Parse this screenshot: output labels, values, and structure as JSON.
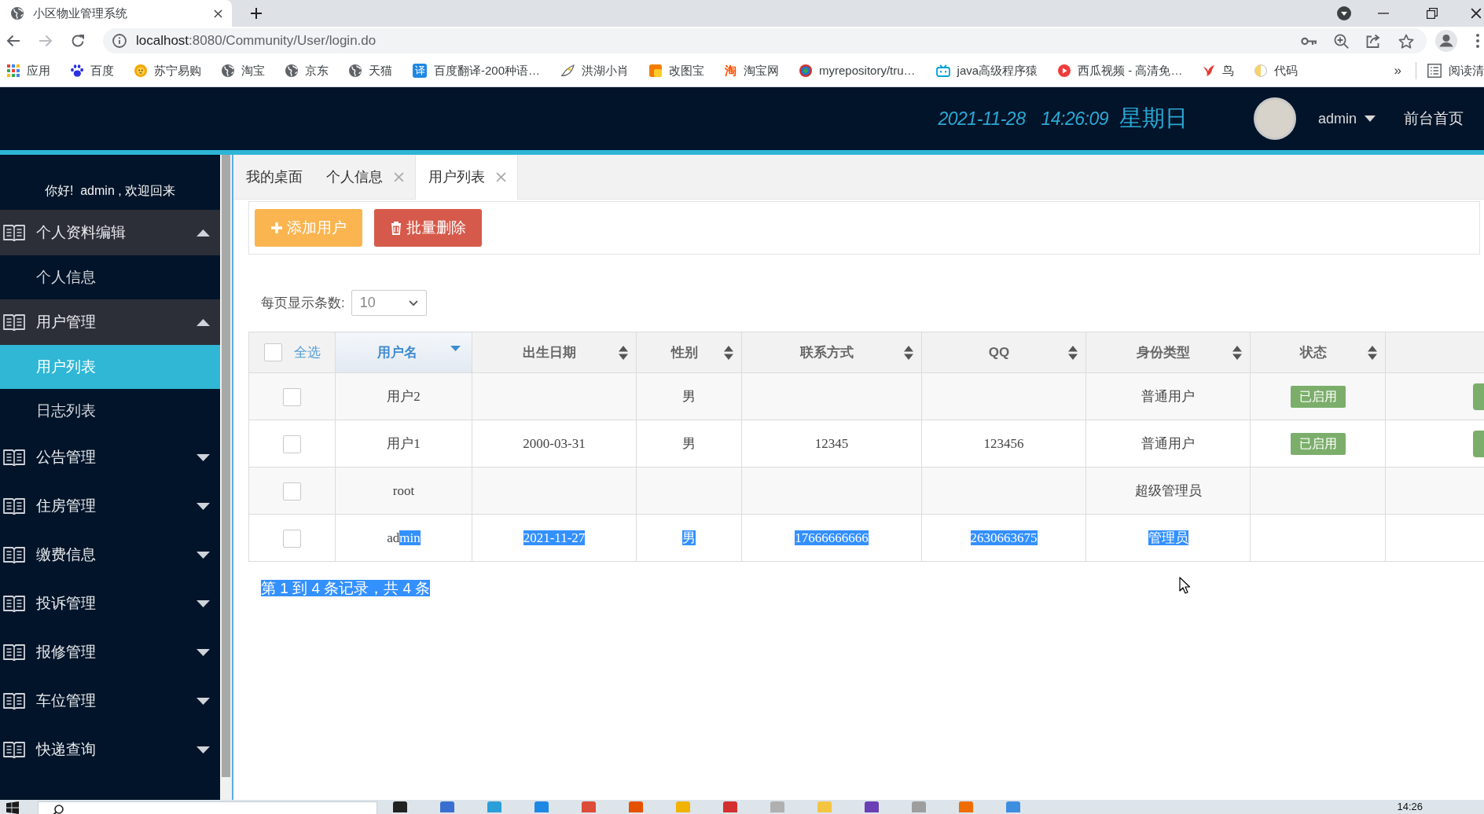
{
  "browser": {
    "tab_title": "小区物业管理系统",
    "nav": [
      {
        "kind": "back",
        "disabled": false
      },
      {
        "kind": "forward",
        "disabled": true
      },
      {
        "kind": "reload",
        "disabled": false
      }
    ],
    "url": {
      "host": "localhost",
      "rest": ":8080/Community/User/login.do"
    },
    "bookmarks": [
      {
        "label": "应用",
        "kind": "apps"
      },
      {
        "label": "百度",
        "kind": "paw"
      },
      {
        "label": "苏宁易购",
        "kind": "lion"
      },
      {
        "label": "淘宝",
        "kind": "globe"
      },
      {
        "label": "京东",
        "kind": "globe"
      },
      {
        "label": "天猫",
        "kind": "globe"
      },
      {
        "label": "百度翻译-200种语…",
        "kind": "glyph_tile",
        "glyph": "译"
      },
      {
        "label": "洪湖小肖",
        "kind": "doodle"
      },
      {
        "label": "改图宝",
        "kind": "tile"
      },
      {
        "label": "淘宝网",
        "kind": "glyph",
        "glyph": "淘"
      },
      {
        "label": "myrepository/tru…",
        "kind": "ring"
      },
      {
        "label": "java高级程序猿",
        "kind": "tv"
      },
      {
        "label": "西瓜视频 - 高清免…",
        "kind": "play"
      },
      {
        "label": "鸟",
        "kind": "bird"
      },
      {
        "label": "代码",
        "kind": "half_circle"
      }
    ],
    "more_bookmarks": "»",
    "reading_list": "阅读清"
  },
  "header": {
    "date": "2021-11-28",
    "time": "14:26:09",
    "weekday": "星期日",
    "user": "admin",
    "home_link": "前台首页"
  },
  "sidebar": {
    "greeting": "你好!  admin , 欢迎回来",
    "groups": [
      {
        "label": "个人资料编辑",
        "expanded": true,
        "children": [
          {
            "label": "个人信息",
            "selected": false
          }
        ]
      },
      {
        "label": "用户管理",
        "expanded": true,
        "children": [
          {
            "label": "用户列表",
            "selected": true
          },
          {
            "label": "日志列表",
            "selected": false
          }
        ]
      },
      {
        "label": "公告管理",
        "expanded": false
      },
      {
        "label": "住房管理",
        "expanded": false
      },
      {
        "label": "缴费信息",
        "expanded": false
      },
      {
        "label": "投诉管理",
        "expanded": false
      },
      {
        "label": "报修管理",
        "expanded": false
      },
      {
        "label": "车位管理",
        "expanded": false
      },
      {
        "label": "快递查询",
        "expanded": false
      }
    ]
  },
  "page_tabs": [
    {
      "label": "我的桌面",
      "closable": false,
      "selected": false
    },
    {
      "label": "个人信息",
      "closable": true,
      "selected": false
    },
    {
      "label": "用户列表",
      "closable": true,
      "selected": true
    }
  ],
  "toolbar": {
    "buttons": [
      {
        "label": "添加用户",
        "kind": "add"
      },
      {
        "label": "批量删除",
        "kind": "delete"
      }
    ]
  },
  "page_size": {
    "label": "每页显示条数:",
    "value": "10"
  },
  "table": {
    "columns": [
      {
        "label": "全选",
        "kind": "select_all",
        "checked": false
      },
      {
        "label": "用户名",
        "kind": "sortable",
        "sorted": true
      },
      {
        "label": "出生日期",
        "kind": "sortable",
        "sorted": false
      },
      {
        "label": "性别",
        "kind": "sortable",
        "sorted": false
      },
      {
        "label": "联系方式",
        "kind": "sortable",
        "sorted": false
      },
      {
        "label": "QQ",
        "kind": "sortable",
        "sorted": false
      },
      {
        "label": "身份类型",
        "kind": "sortable",
        "sorted": false
      },
      {
        "label": "状态",
        "kind": "sortable",
        "sorted": false
      }
    ],
    "rows": [
      {
        "checked": false,
        "highlighted": false,
        "username": [
          {
            "text": "用户2",
            "highlighted": false
          }
        ],
        "gender": "男",
        "role": "普通用户",
        "status": "已启用",
        "has_action_button": true
      },
      {
        "checked": false,
        "highlighted": false,
        "username": [
          {
            "text": "用户1",
            "highlighted": false
          }
        ],
        "birth_date": "2000-03-31",
        "gender": "男",
        "phone": "12345",
        "qq": "123456",
        "role": "普通用户",
        "status": "已启用",
        "has_action_button": true
      },
      {
        "checked": false,
        "highlighted": false,
        "username": [
          {
            "text": "root",
            "highlighted": false
          }
        ],
        "role": "超级管理员",
        "has_action_button": false
      },
      {
        "checked": false,
        "highlighted": true,
        "username": [
          {
            "text": "ad",
            "highlighted": false
          },
          {
            "text": "min",
            "highlighted": true
          }
        ],
        "birth_date": "2021-11-27",
        "gender": "男",
        "phone": "17666666666",
        "qq": "2630663675",
        "role": "管理员",
        "has_action_button": false
      }
    ]
  },
  "footer": {
    "summary": "第 1 到 4 条记录，共 4 条",
    "highlighted": true
  },
  "taskbar": {
    "time": "14:26"
  }
}
